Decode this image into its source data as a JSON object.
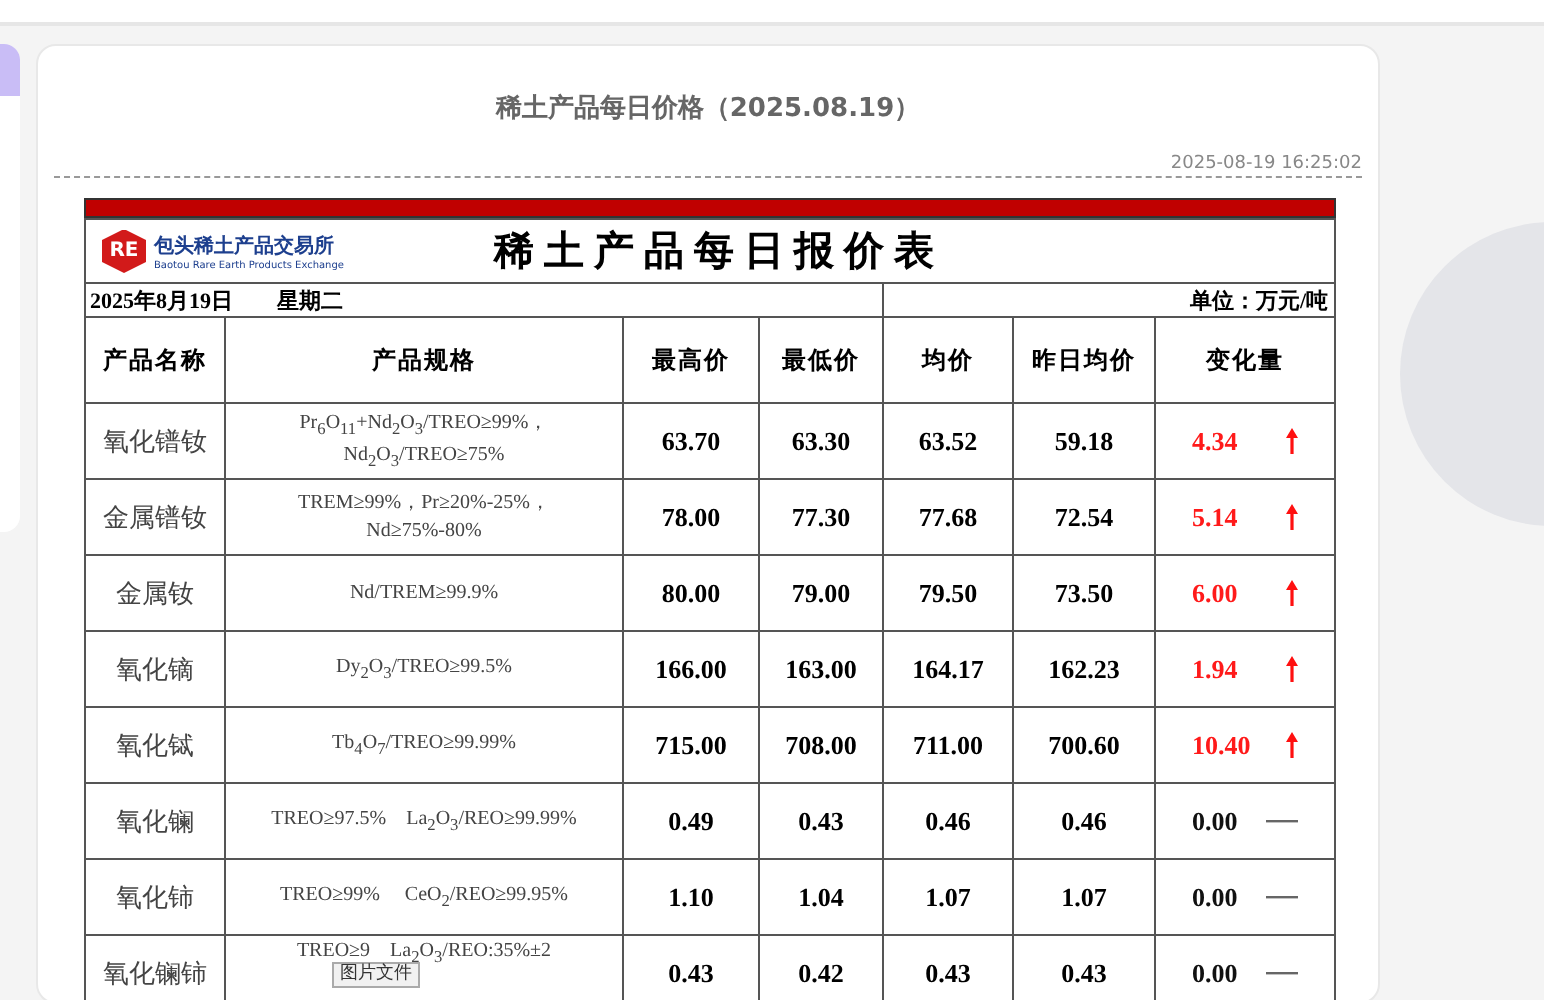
{
  "article": {
    "title": "稀土产品每日价格（2025.08.19）",
    "timestamp": "2025-08-19 16:25:02"
  },
  "price_sheet": {
    "logo_mark": "RE",
    "logo_name": "包头稀土产品交易所",
    "logo_name_en": "Baotou Rare Earth Products Exchange",
    "title": "稀 土 产 品 每 日 报 价 表",
    "date": "2025年8月19日",
    "weekday": "星期二",
    "unit": "单位：万元/吨",
    "columns": [
      "产品名称",
      "产品规格",
      "最高价",
      "最低价",
      "均价",
      "昨日均价",
      "变化量"
    ],
    "rows": [
      {
        "name": "氧化镨钕",
        "spec": [
          "Pr$_{6}$O$_{11}$+Nd$_{2}$O$_{3}$/TREO≥99%，",
          "Nd$_{2}$O$_{3}$/TREO≥75%"
        ],
        "high": "63.70",
        "low": "63.30",
        "avg": "63.52",
        "prev": "59.18",
        "change": "4.34",
        "rising": true
      },
      {
        "name": "金属镨钕",
        "spec": [
          "TREM≥99%，Pr≥20%-25%，",
          "Nd≥75%-80%"
        ],
        "high": "78.00",
        "low": "77.30",
        "avg": "77.68",
        "prev": "72.54",
        "change": "5.14",
        "rising": true
      },
      {
        "name": "金属钕",
        "spec": [
          "Nd/TREM≥99.9%"
        ],
        "high": "80.00",
        "low": "79.00",
        "avg": "79.50",
        "prev": "73.50",
        "change": "6.00",
        "rising": true
      },
      {
        "name": "氧化镝",
        "spec": [
          "Dy$_{2}$O$_{3}$/TREO≥99.5%"
        ],
        "high": "166.00",
        "low": "163.00",
        "avg": "164.17",
        "prev": "162.23",
        "change": "1.94",
        "rising": true
      },
      {
        "name": "氧化铽",
        "spec": [
          "Tb$_{4}$O$_{7}$/TREO≥99.99%"
        ],
        "high": "715.00",
        "low": "708.00",
        "avg": "711.00",
        "prev": "700.60",
        "change": "10.40",
        "rising": true
      },
      {
        "name": "氧化镧",
        "spec": [
          "TREO≥97.5%　La$_{2}$O$_{3}$/REO≥99.99%"
        ],
        "high": "0.49",
        "low": "0.43",
        "avg": "0.46",
        "prev": "0.46",
        "change": "0.00",
        "rising": false
      },
      {
        "name": "氧化铈",
        "spec": [
          "TREO≥99%　 CeO$_{2}$/REO≥99.95%"
        ],
        "high": "1.10",
        "low": "1.04",
        "avg": "1.07",
        "prev": "1.07",
        "change": "0.00",
        "rising": false
      },
      {
        "name": "氧化镧铈",
        "spec": [
          "TREO≥9　La$_{2}$O$_{3}$/REO:35%±2"
        ],
        "high": "0.43",
        "low": "0.42",
        "avg": "0.43",
        "prev": "0.43",
        "change": "0.00",
        "rising": false
      }
    ]
  },
  "tooltip": "图片文件"
}
